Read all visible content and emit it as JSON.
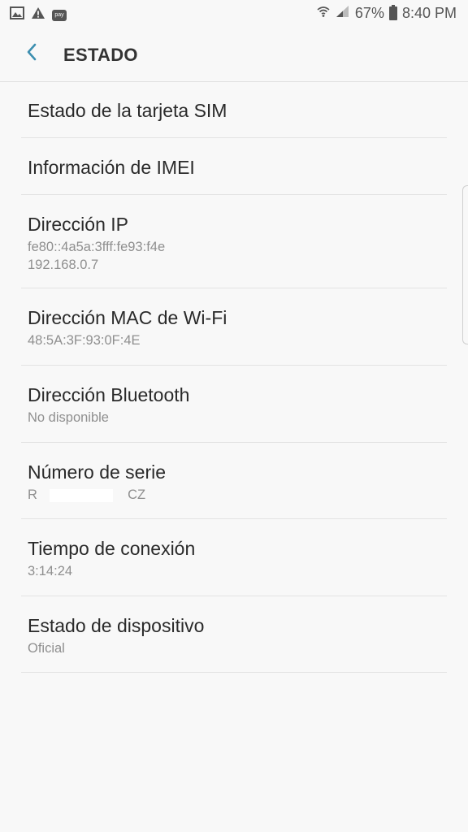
{
  "status_bar": {
    "battery": "67%",
    "time": "8:40 PM",
    "icons": [
      "image-icon",
      "warning-icon",
      "pay-icon",
      "wifi-icon",
      "signal-icon",
      "battery-icon"
    ],
    "pay_label": "pay"
  },
  "header": {
    "title": "ESTADO",
    "back_icon": "chevron-left-icon",
    "accent_color": "#3d8fb0"
  },
  "items": [
    {
      "title": "Estado de la tarjeta SIM",
      "lines": []
    },
    {
      "title": "Información de IMEI",
      "lines": []
    },
    {
      "title": "Dirección IP",
      "lines": [
        "fe80::4a5a:3fff:fe93:f4e",
        "192.168.0.7"
      ]
    },
    {
      "title": "Dirección MAC de Wi-Fi",
      "lines": [
        "48:5A:3F:93:0F:4E"
      ]
    },
    {
      "title": "Dirección Bluetooth",
      "lines": [
        "No disponible"
      ]
    },
    {
      "title": "Número de serie",
      "serial_prefix": "R",
      "serial_suffix": "CZ"
    },
    {
      "title": "Tiempo de conexión",
      "lines": [
        "3:14:24"
      ]
    },
    {
      "title": "Estado de dispositivo",
      "lines": [
        "Oficial"
      ]
    }
  ]
}
